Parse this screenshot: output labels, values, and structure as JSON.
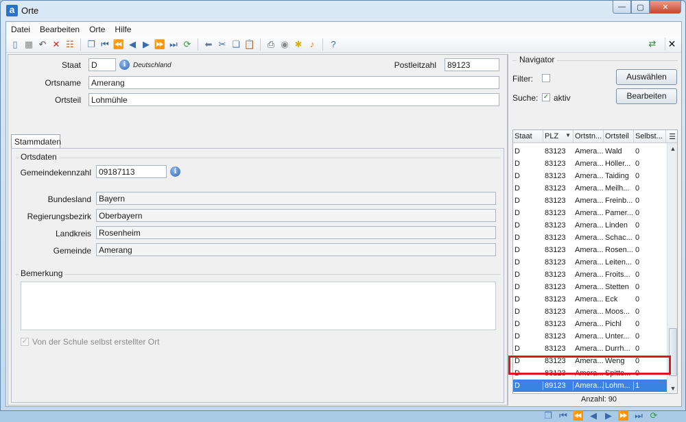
{
  "window": {
    "title": "Orte",
    "app_icon_letter": "a",
    "close_glyph": "✕",
    "min_glyph": "—",
    "max_glyph": "▢"
  },
  "menu": [
    {
      "label": "Datei"
    },
    {
      "label": "Bearbeiten"
    },
    {
      "label": "Orte"
    },
    {
      "label": "Hilfe"
    }
  ],
  "toolbar": {
    "icons": [
      "new-icon",
      "save-icon",
      "undo-icon",
      "delete-icon",
      "edit-list-icon",
      "sep",
      "copy-record-icon",
      "first-icon",
      "prev-page-icon",
      "prev-icon",
      "next-icon",
      "next-page-icon",
      "last-icon",
      "refresh-icon",
      "sep",
      "back-arrow-icon",
      "cut-icon",
      "copy-icon",
      "paste-icon",
      "sep",
      "print-icon",
      "preview-icon",
      "hint-icon",
      "bell-icon",
      "sep",
      "help-icon"
    ],
    "right_icons": [
      "export-icon"
    ],
    "close_glyph": "✕"
  },
  "form": {
    "staat_label": "Staat",
    "staat_value": "D",
    "staat_note": "Deutschland",
    "plz_label": "Postleitzahl",
    "plz_value": "89123",
    "ortsname_label": "Ortsname",
    "ortsname_value": "Amerang",
    "ortsteil_label": "Ortsteil",
    "ortsteil_value": "Lohmühle",
    "tab_label": "Stammdaten",
    "ortsdaten_title": "Ortsdaten",
    "gkz_label": "Gemeindekennzahl",
    "gkz_value": "09187113",
    "bundesland_label": "Bundesland",
    "bundesland_value": "Bayern",
    "regbez_label": "Regierungsbezirk",
    "regbez_value": "Oberbayern",
    "landkreis_label": "Landkreis",
    "landkreis_value": "Rosenheim",
    "gemeinde_label": "Gemeinde",
    "gemeinde_value": "Amerang",
    "bemerkung_title": "Bemerkung",
    "bemerkung_value": "",
    "selbst_label": "Von der Schule selbst erstellter Ort",
    "info_glyph": "i"
  },
  "navigator": {
    "title": "Navigator",
    "filter_label": "Filter:",
    "filter_checked": false,
    "suche_label": "Suche:",
    "suche_checked": true,
    "aktiv_label": "aktiv",
    "auswaehlen_label": "Auswählen",
    "bearbeiten_label": "Bearbeiten",
    "columns": [
      "Staat",
      "PLZ",
      "Ortstn...",
      "Ortsteil",
      "Selbst..."
    ],
    "rows": [
      [
        "D",
        "83123",
        "Amera...",
        "Wald",
        "0"
      ],
      [
        "D",
        "83123",
        "Amera...",
        "Höller...",
        "0"
      ],
      [
        "D",
        "83123",
        "Amera...",
        "Taiding",
        "0"
      ],
      [
        "D",
        "83123",
        "Amera...",
        "Meilh...",
        "0"
      ],
      [
        "D",
        "83123",
        "Amera...",
        "Freinb...",
        "0"
      ],
      [
        "D",
        "83123",
        "Amera...",
        "Pamer...",
        "0"
      ],
      [
        "D",
        "83123",
        "Amera...",
        "Linden",
        "0"
      ],
      [
        "D",
        "83123",
        "Amera...",
        "Schac...",
        "0"
      ],
      [
        "D",
        "83123",
        "Amera...",
        "Rosen...",
        "0"
      ],
      [
        "D",
        "83123",
        "Amera...",
        "Leiten...",
        "0"
      ],
      [
        "D",
        "83123",
        "Amera...",
        "Froits...",
        "0"
      ],
      [
        "D",
        "83123",
        "Amera...",
        "Stetten",
        "0"
      ],
      [
        "D",
        "83123",
        "Amera...",
        "Eck",
        "0"
      ],
      [
        "D",
        "83123",
        "Amera...",
        "Moos...",
        "0"
      ],
      [
        "D",
        "83123",
        "Amera...",
        "Pichl",
        "0"
      ],
      [
        "D",
        "83123",
        "Amera...",
        "Unter...",
        "0"
      ],
      [
        "D",
        "83123",
        "Amera...",
        "Durrh...",
        "0"
      ],
      [
        "D",
        "83123",
        "Amera...",
        "Weng",
        "0"
      ],
      [
        "D",
        "83123",
        "Amera...",
        "Spitte...",
        "0"
      ]
    ],
    "selected_row": [
      "D",
      "89123",
      "Amera...",
      "Lohm...",
      "1"
    ],
    "count_text": "Anzahl: 90",
    "nav_icons": [
      "copy-record-icon",
      "first-icon",
      "prev-page-icon",
      "prev-icon",
      "next-icon",
      "next-page-icon",
      "last-icon",
      "refresh-icon"
    ]
  }
}
